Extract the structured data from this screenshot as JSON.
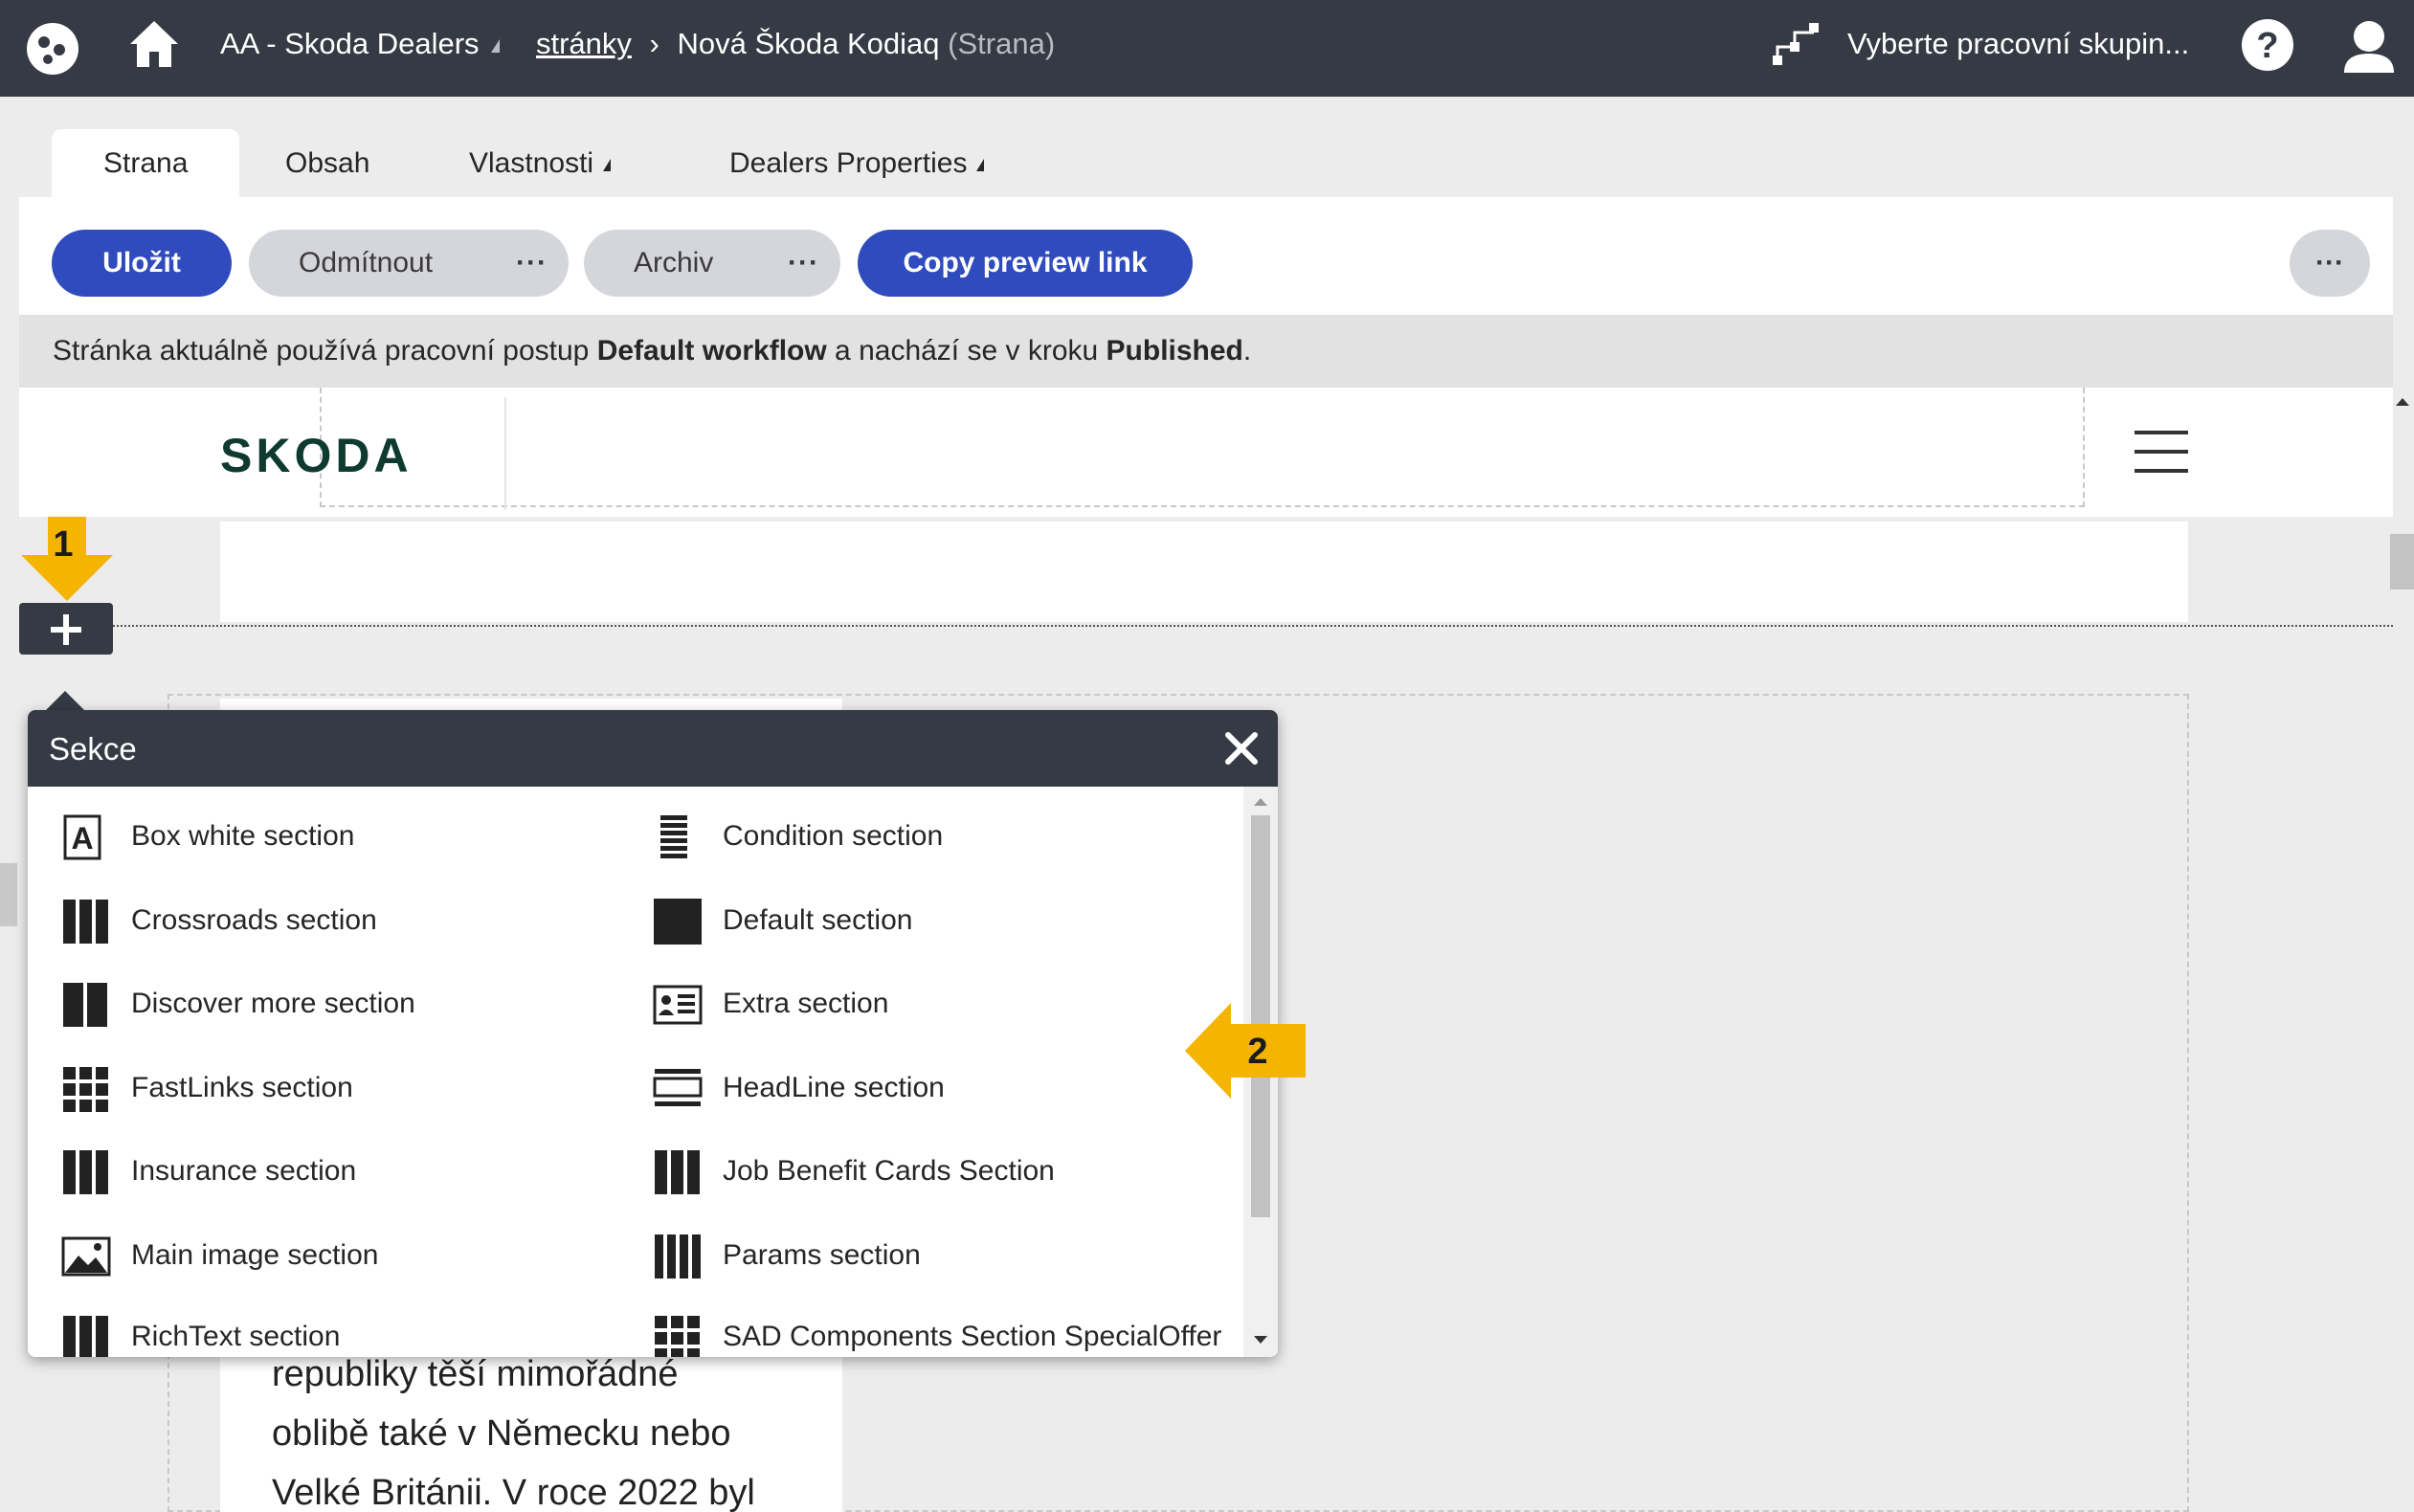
{
  "topbar": {
    "site": "AA - Skoda Dealers",
    "breadcrumb_link": "stránky",
    "page_name": "Nová Škoda Kodiaq",
    "page_type": "(Strana)",
    "workgroup": "Vyberte pracovní skupin..."
  },
  "tabs": [
    "Strana",
    "Obsah",
    "Vlastnosti",
    "Dealers Properties"
  ],
  "toolbar": {
    "save": "Uložit",
    "reject": "Odmítnout",
    "archive": "Archiv",
    "copy_preview": "Copy preview link",
    "more": "···"
  },
  "workflow_info": {
    "prefix": "Stránka aktuálně používá pracovní postup ",
    "workflow": "Default workflow",
    "middle": " a nachází se v kroku ",
    "step": "Published",
    "suffix": "."
  },
  "preview": {
    "logo": "SKODA",
    "body_lines": [
      "republiky těší mimořádné",
      "oblibě také v Německu nebo",
      "Velké Británii. V roce 2022 byl"
    ]
  },
  "callouts": {
    "first": "1",
    "second": "2"
  },
  "popup": {
    "title": "Sekce",
    "items": [
      {
        "label": "Box white section",
        "icon": "box-letter-a-icon"
      },
      {
        "label": "Condition section",
        "icon": "horizontal-lines-icon"
      },
      {
        "label": "Crossroads section",
        "icon": "three-columns-icon"
      },
      {
        "label": "Default section",
        "icon": "solid-square-icon"
      },
      {
        "label": "Discover more section",
        "icon": "two-columns-icon"
      },
      {
        "label": "Extra section",
        "icon": "id-card-icon"
      },
      {
        "label": "FastLinks section",
        "icon": "grid-3x3-icon"
      },
      {
        "label": "HeadLine section",
        "icon": "headline-icon"
      },
      {
        "label": "Insurance section",
        "icon": "three-columns-icon"
      },
      {
        "label": "Job Benefit Cards Section",
        "icon": "three-columns-icon"
      },
      {
        "label": "Main image section",
        "icon": "image-icon"
      },
      {
        "label": "Params section",
        "icon": "four-columns-icon"
      },
      {
        "label": "RichText section",
        "icon": "three-columns-icon"
      },
      {
        "label": "SAD Components Section SpecialOffer",
        "icon": "grid-3x3-icon"
      }
    ]
  },
  "colors": {
    "topbar": "#353a44",
    "primary": "#2f4bbd",
    "callout": "#f5b400",
    "logo": "#0e3a2f"
  }
}
